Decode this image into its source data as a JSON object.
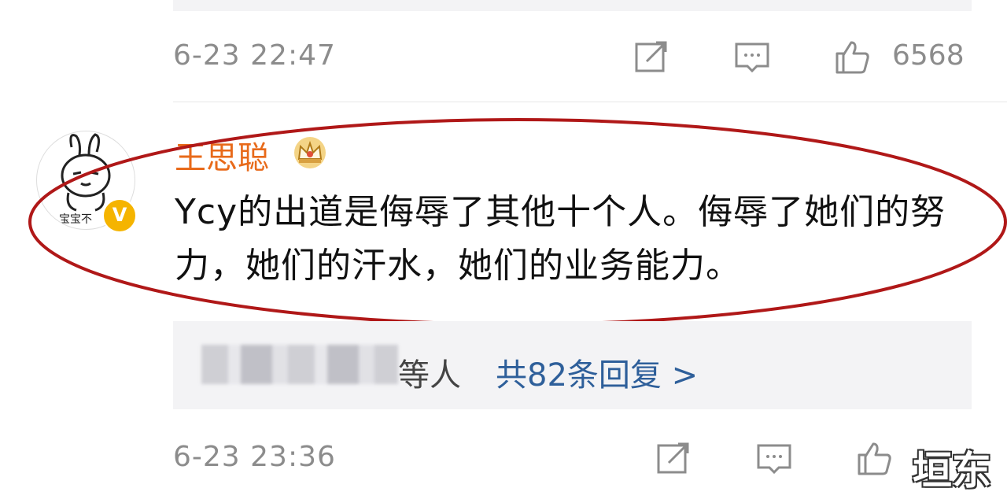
{
  "post_1": {
    "timestamp": "6-23 22:47",
    "like_count": "6568"
  },
  "comment": {
    "username": "王思聪",
    "avatar_text": "宝宝不",
    "verified_badge": "V",
    "text": "Ycy的出道是侮辱了其他十个人。侮辱了她们的努力，她们的汗水，她们的业务能力。",
    "replies_prefix": "等人",
    "replies_link": "共82条回复 >"
  },
  "post_2": {
    "timestamp": "6-23 23:36"
  },
  "watermark": "垣东",
  "colors": {
    "username": "#e86a1a",
    "link": "#2e5f9a",
    "highlight_ellipse": "#b01818",
    "verified_badge": "#f5b400"
  },
  "icons": [
    "share-icon",
    "comment-icon",
    "like-icon",
    "crown-icon"
  ]
}
